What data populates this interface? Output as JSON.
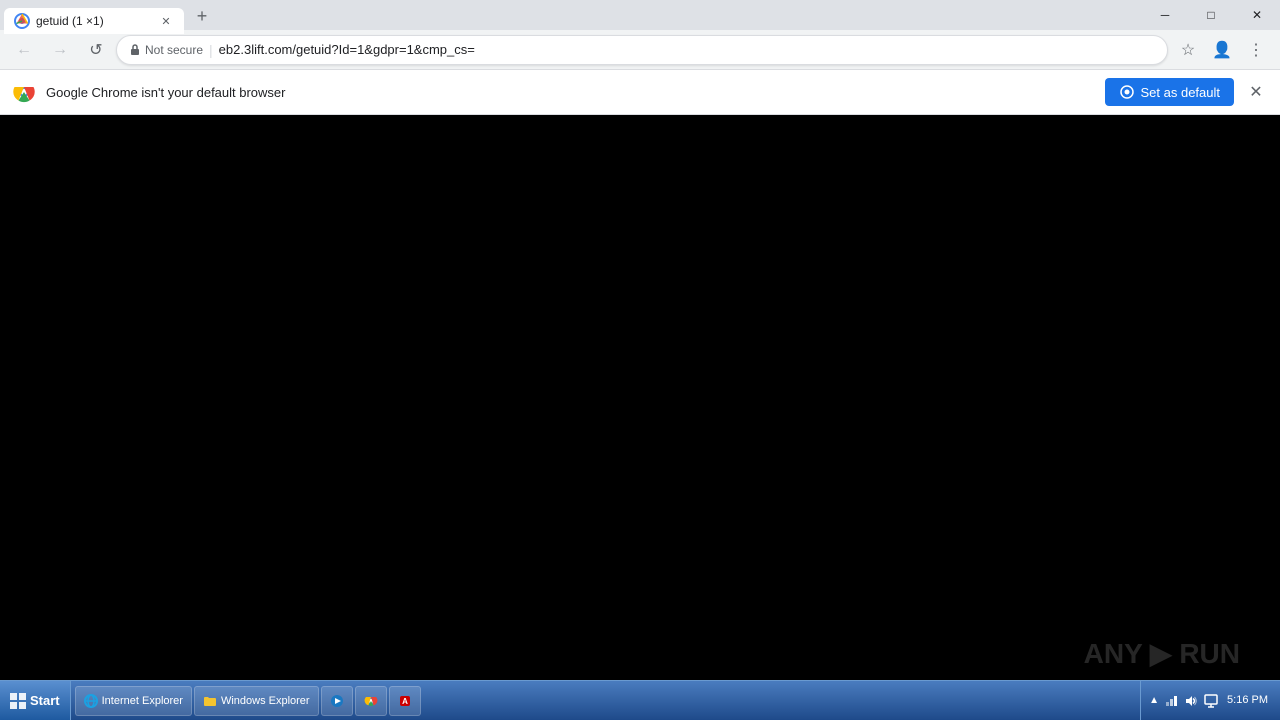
{
  "titlebar": {
    "tab": {
      "title": "getuid (1 ×1)",
      "favicon": "chrome-favicon"
    },
    "new_tab_label": "+",
    "window_controls": {
      "minimize": "─",
      "maximize": "□",
      "close": "✕"
    }
  },
  "toolbar": {
    "back_label": "←",
    "forward_label": "→",
    "reload_label": "↺",
    "security_label": "Not secure",
    "address": "eb2.3lift.com/getuid?Id=1&gdpr=1&cmp_cs=",
    "bookmark_label": "☆",
    "profile_label": "👤",
    "menu_label": "⋮"
  },
  "infobar": {
    "message": "Google Chrome isn't your default browser",
    "set_default_label": "Set as default",
    "close_label": "✕"
  },
  "taskbar": {
    "start_label": "Start",
    "items": [
      {
        "label": "Internet Explorer"
      },
      {
        "label": "Windows Explorer"
      },
      {
        "label": "Windows Media"
      },
      {
        "label": "Chrome"
      },
      {
        "label": "App"
      }
    ],
    "tray": {
      "time": "5:16 PM",
      "show_hidden": "▲"
    }
  },
  "watermark": {
    "text": "ANY▶RUN"
  }
}
